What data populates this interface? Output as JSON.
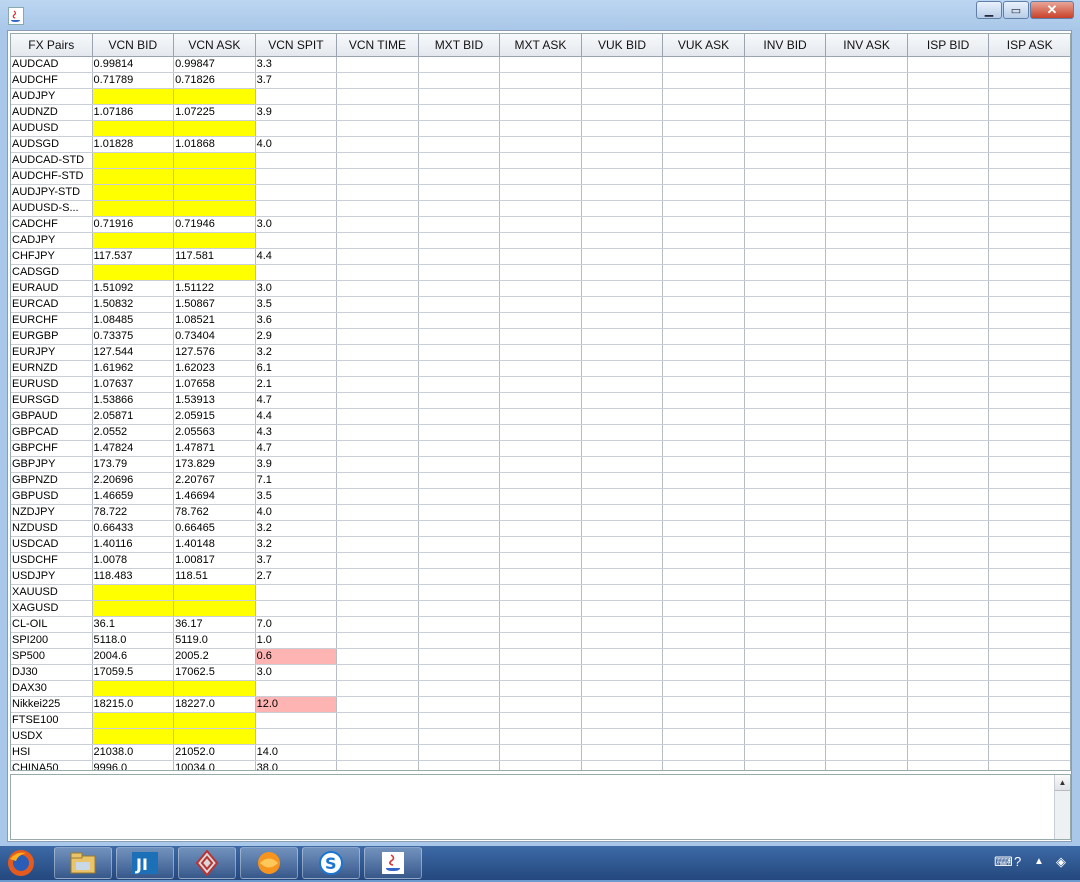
{
  "window": {
    "title": "",
    "minimize_label": "▁",
    "maximize_label": "▭",
    "close_label": "✕"
  },
  "columns": [
    "FX Pairs",
    "VCN BID",
    "VCN ASK",
    "VCN SPIT",
    "VCN TIME",
    "MXT BID",
    "MXT ASK",
    "VUK BID",
    "VUK ASK",
    "INV BID",
    "INV ASK",
    "ISP BID",
    "ISP ASK"
  ],
  "rows": [
    {
      "pair": "AUDCAD",
      "bid": "0.99814",
      "ask": "0.99847",
      "spit": "3.3"
    },
    {
      "pair": "AUDCHF",
      "bid": "0.71789",
      "ask": "0.71826",
      "spit": "3.7"
    },
    {
      "pair": " AUDJPY",
      "bid": "",
      "ask": "",
      "spit": "",
      "hl": "yellow"
    },
    {
      "pair": "AUDNZD",
      "bid": "1.07186",
      "ask": "1.07225",
      "spit": "3.9"
    },
    {
      "pair": " AUDUSD",
      "bid": "",
      "ask": "",
      "spit": "",
      "hl": "yellow"
    },
    {
      "pair": "AUDSGD",
      "bid": "1.01828",
      "ask": "1.01868",
      "spit": "4.0"
    },
    {
      "pair": "AUDCAD-STD",
      "bid": "",
      "ask": "",
      "spit": "",
      "hl": "yellow"
    },
    {
      "pair": "AUDCHF-STD",
      "bid": "",
      "ask": "",
      "spit": "",
      "hl": "yellow"
    },
    {
      "pair": "AUDJPY-STD",
      "bid": "",
      "ask": "",
      "spit": "",
      "hl": "yellow"
    },
    {
      "pair": "AUDUSD-S...",
      "bid": "",
      "ask": "",
      "spit": "",
      "hl": "yellow"
    },
    {
      "pair": "CADCHF",
      "bid": "0.71916",
      "ask": "0.71946",
      "spit": "3.0"
    },
    {
      "pair": " CADJPY",
      "bid": "",
      "ask": "",
      "spit": "",
      "hl": "yellow"
    },
    {
      "pair": "CHFJPY",
      "bid": "117.537",
      "ask": "117.581",
      "spit": "4.4"
    },
    {
      "pair": "CADSGD",
      "bid": "",
      "ask": "",
      "spit": "",
      "hl": "yellow"
    },
    {
      "pair": "EURAUD",
      "bid": "1.51092",
      "ask": "1.51122",
      "spit": "3.0"
    },
    {
      "pair": "EURCAD",
      "bid": "1.50832",
      "ask": "1.50867",
      "spit": "3.5"
    },
    {
      "pair": "EURCHF",
      "bid": "1.08485",
      "ask": "1.08521",
      "spit": "3.6"
    },
    {
      "pair": "EURGBP",
      "bid": "0.73375",
      "ask": "0.73404",
      "spit": "2.9"
    },
    {
      "pair": "EURJPY",
      "bid": "127.544",
      "ask": "127.576",
      "spit": "3.2"
    },
    {
      "pair": "EURNZD",
      "bid": "1.61962",
      "ask": "1.62023",
      "spit": "6.1"
    },
    {
      "pair": "EURUSD",
      "bid": "1.07637",
      "ask": "1.07658",
      "spit": "2.1"
    },
    {
      "pair": "EURSGD",
      "bid": "1.53866",
      "ask": "1.53913",
      "spit": "4.7"
    },
    {
      "pair": "GBPAUD",
      "bid": "2.05871",
      "ask": "2.05915",
      "spit": "4.4"
    },
    {
      "pair": "GBPCAD",
      "bid": "2.0552",
      "ask": "2.05563",
      "spit": "4.3"
    },
    {
      "pair": "GBPCHF",
      "bid": "1.47824",
      "ask": "1.47871",
      "spit": "4.7"
    },
    {
      "pair": "GBPJPY",
      "bid": "173.79",
      "ask": "173.829",
      "spit": "3.9"
    },
    {
      "pair": "GBPNZD",
      "bid": "2.20696",
      "ask": "2.20767",
      "spit": "7.1"
    },
    {
      "pair": "GBPUSD",
      "bid": "1.46659",
      "ask": "1.46694",
      "spit": "3.5"
    },
    {
      "pair": "NZDJPY",
      "bid": "78.722",
      "ask": "78.762",
      "spit": "4.0"
    },
    {
      "pair": "NZDUSD",
      "bid": "0.66433",
      "ask": "0.66465",
      "spit": "3.2"
    },
    {
      "pair": "USDCAD",
      "bid": "1.40116",
      "ask": "1.40148",
      "spit": "3.2"
    },
    {
      "pair": "USDCHF",
      "bid": "1.0078",
      "ask": "1.00817",
      "spit": "3.7"
    },
    {
      "pair": "USDJPY",
      "bid": "118.483",
      "ask": "118.51",
      "spit": "2.7"
    },
    {
      "pair": " XAUUSD",
      "bid": "",
      "ask": "",
      "spit": "",
      "hl": "yellow"
    },
    {
      "pair": "XAGUSD",
      "bid": "",
      "ask": "",
      "spit": "",
      "hl": "yellow"
    },
    {
      "pair": "CL-OIL",
      "bid": "36.1",
      "ask": "36.17",
      "spit": "7.0"
    },
    {
      "pair": "SPI200",
      "bid": "5118.0",
      "ask": "5119.0",
      "spit": "1.0"
    },
    {
      "pair": "SP500",
      "bid": "2004.6",
      "ask": "2005.2",
      "spit": "0.6",
      "spit_hl": "pink"
    },
    {
      "pair": "DJ30",
      "bid": "17059.5",
      "ask": "17062.5",
      "spit": "3.0"
    },
    {
      "pair": "DAX30",
      "bid": "",
      "ask": "",
      "spit": "",
      "hl": "yellow"
    },
    {
      "pair": "Nikkei225",
      "bid": "18215.0",
      "ask": "18227.0",
      "spit": "12.0",
      "spit_hl": "pink"
    },
    {
      "pair": "FTSE100",
      "bid": "",
      "ask": "",
      "spit": "",
      "hl": "yellow"
    },
    {
      "pair": "USDX",
      "bid": "",
      "ask": "",
      "spit": "",
      "hl": "yellow"
    },
    {
      "pair": "HSI",
      "bid": "21038.0",
      "ask": "21052.0",
      "spit": "14.0"
    },
    {
      "pair": "CHINA50",
      "bid": "9996.0",
      "ask": "10034.0",
      "spit": "38.0"
    }
  ],
  "colors": {
    "highlight_yellow": "#ffff00",
    "highlight_pink": "#ffb4b4"
  },
  "log": {
    "text": ""
  },
  "taskbar": {
    "items": [
      "firefox-icon",
      "file-manager-icon",
      "intellij-icon",
      "renault-icon",
      "orange-app-icon",
      "s-app-icon",
      "java-icon"
    ],
    "tray": [
      "keyboard-icon",
      "help-icon",
      "show-hidden-icon",
      "network-icon"
    ]
  }
}
